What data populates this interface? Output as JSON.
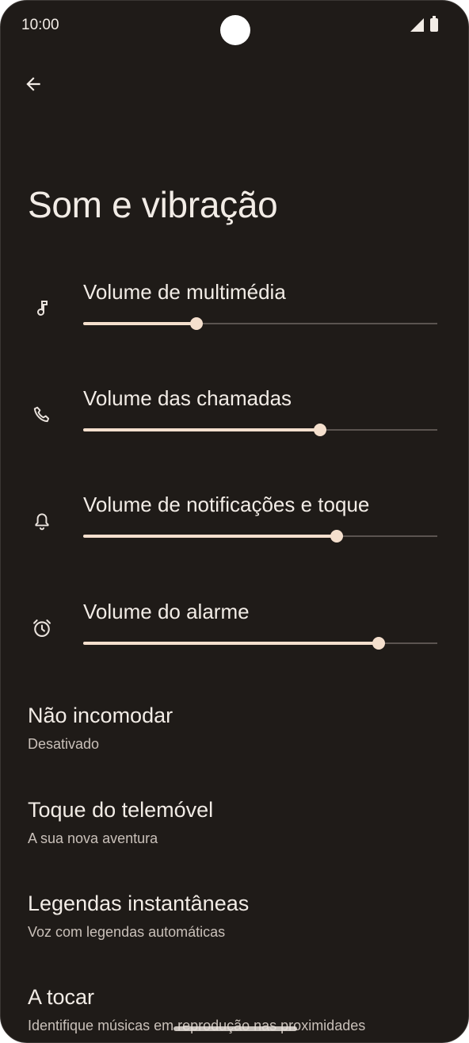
{
  "status_bar": {
    "time": "10:00",
    "icons": [
      "signal-icon",
      "battery-icon"
    ]
  },
  "header": {
    "back_icon": "arrow-back-icon",
    "title": "Som e vibração"
  },
  "volumes": [
    {
      "label": "Volume de multimédia",
      "icon": "music-note-icon",
      "level": 0.32
    },
    {
      "label": "Volume das chamadas",
      "icon": "phone-icon",
      "level": 0.67
    },
    {
      "label": "Volume de notificações e toque",
      "icon": "bell-icon",
      "level": 0.715
    },
    {
      "label": "Volume do alarme",
      "icon": "alarm-clock-icon",
      "level": 0.835
    }
  ],
  "settings": [
    {
      "title": "Não incomodar",
      "subtitle": "Desativado"
    },
    {
      "title": "Toque do telemóvel",
      "subtitle": "A sua nova aventura"
    },
    {
      "title": "Legendas instantâneas",
      "subtitle": "Voz com legendas automáticas"
    },
    {
      "title": "A tocar",
      "subtitle": "Identifique músicas em reprodução nas proximidades"
    }
  ],
  "colors": {
    "background": "#1f1b18",
    "accent": "#f4dfcd",
    "text": "#f2ece6",
    "subtext": "#c9c0b9"
  }
}
